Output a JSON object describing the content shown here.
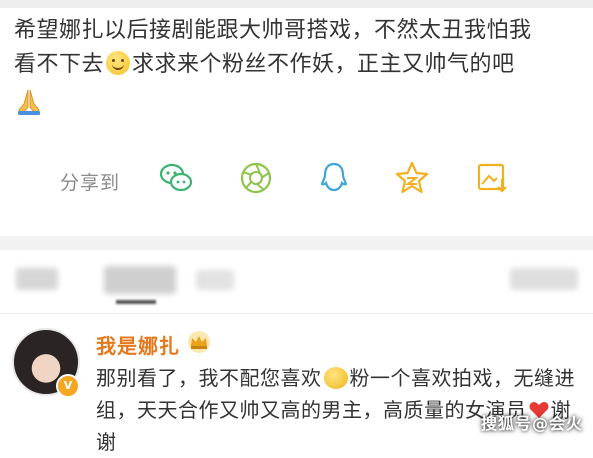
{
  "post": {
    "line1": "希望娜扎以后接剧能跟大帅哥搭戏，不然太丑我怕我",
    "line2_a": "看不下去",
    "line2_b": "求求来个粉丝不作妖，正主又帅气的吧",
    "emoji1": "smile-emoji",
    "emoji2": "pray-emoji"
  },
  "share": {
    "label": "分享到",
    "icons": [
      "wechat-icon",
      "moments-icon",
      "qq-icon",
      "qzone-icon",
      "save-image-icon"
    ],
    "accent": "#3cb371"
  },
  "comment": {
    "username": "我是娜扎",
    "badge": "V",
    "text_a": "那别看了，我不配您喜欢",
    "text_b": "粉一个喜欢拍戏，无缝进组，天天合作又帅又高的男主，高质量的女演员",
    "text_c": "谢谢",
    "username_color": "#e3781c"
  },
  "watermark": "搜狐号@会火"
}
